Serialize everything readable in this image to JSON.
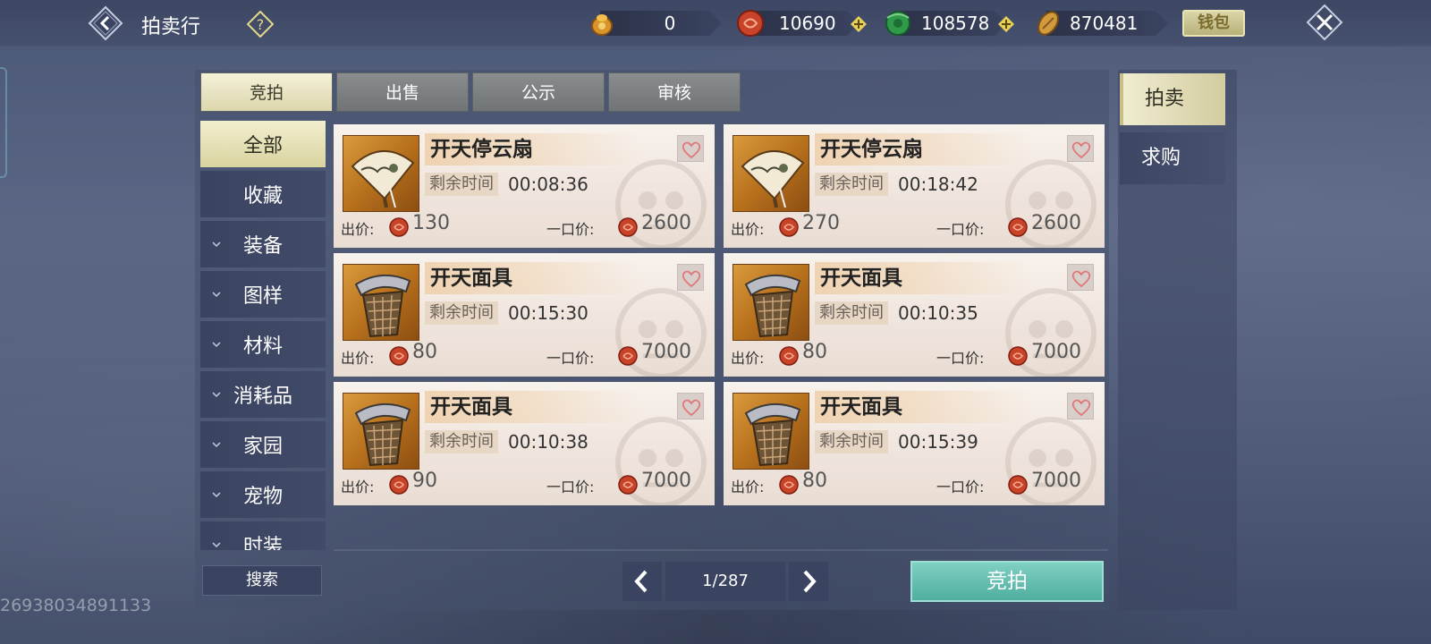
{
  "header": {
    "title": "拍卖行",
    "currencies": [
      {
        "name": "gold-ingot",
        "value": "0"
      },
      {
        "name": "red-coin",
        "value": "10690"
      },
      {
        "name": "jade-coin",
        "value": "108578"
      },
      {
        "name": "copper-coin",
        "value": "870481"
      }
    ],
    "wallet_label": "钱包"
  },
  "tabs": [
    {
      "label": "竞拍",
      "active": true
    },
    {
      "label": "出售",
      "active": false
    },
    {
      "label": "公示",
      "active": false
    },
    {
      "label": "审核",
      "active": false
    }
  ],
  "categories": [
    {
      "label": "全部",
      "active": true,
      "expandable": false
    },
    {
      "label": "收藏",
      "active": false,
      "expandable": false
    },
    {
      "label": "装备",
      "active": false,
      "expandable": true
    },
    {
      "label": "图样",
      "active": false,
      "expandable": true
    },
    {
      "label": "材料",
      "active": false,
      "expandable": true
    },
    {
      "label": "消耗品",
      "active": false,
      "expandable": true
    },
    {
      "label": "家园",
      "active": false,
      "expandable": true
    },
    {
      "label": "宠物",
      "active": false,
      "expandable": true
    },
    {
      "label": "时装",
      "active": false,
      "expandable": true
    }
  ],
  "labels": {
    "time_left": "剩余时间",
    "bid_price": "出价:",
    "buyout_price": "一口价:"
  },
  "listings": [
    {
      "name": "开天停云扇",
      "icon": "fan-icon",
      "time_left": "00:08:36",
      "bid": "130",
      "buyout": "2600"
    },
    {
      "name": "开天停云扇",
      "icon": "fan-icon",
      "time_left": "00:18:42",
      "bid": "270",
      "buyout": "2600"
    },
    {
      "name": "开天面具",
      "icon": "mask-icon",
      "time_left": "00:15:30",
      "bid": "80",
      "buyout": "7000"
    },
    {
      "name": "开天面具",
      "icon": "mask-icon",
      "time_left": "00:10:35",
      "bid": "80",
      "buyout": "7000"
    },
    {
      "name": "开天面具",
      "icon": "mask-icon",
      "time_left": "00:10:38",
      "bid": "90",
      "buyout": "7000"
    },
    {
      "name": "开天面具",
      "icon": "mask-icon",
      "time_left": "00:15:39",
      "bid": "80",
      "buyout": "7000"
    }
  ],
  "side_tabs": [
    {
      "label": "拍卖",
      "active": true
    },
    {
      "label": "求购",
      "active": false
    }
  ],
  "footer": {
    "search_label": "搜索",
    "page": "1/287",
    "auction_button": "竞拍",
    "user_id": "26938034891133"
  },
  "colors": {
    "accent_teal": "#4fae9f",
    "active_tab": "#f0ecd0",
    "background": "#4b5776"
  }
}
